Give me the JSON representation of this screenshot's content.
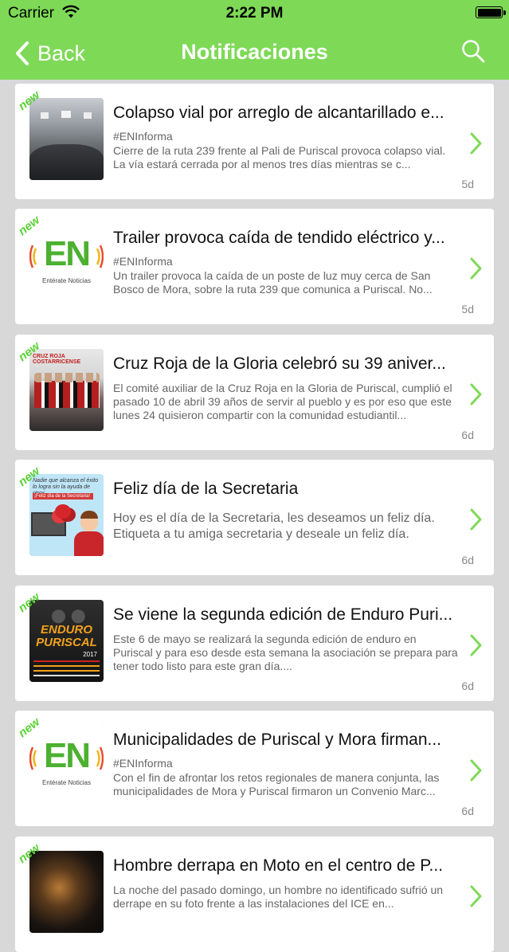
{
  "status_bar": {
    "carrier": "Carrier",
    "time": "2:22 PM"
  },
  "nav": {
    "back_label": "Back",
    "title": "Notificaciones"
  },
  "colors": {
    "accent": "#7ed957",
    "new_badge": "#5cd137",
    "chevron": "#7ed957"
  },
  "notifications": [
    {
      "badge": "new",
      "title": "Colapso vial por arreglo de alcantarillado e...",
      "tag": "#ENInforma",
      "description": "Cierre de la ruta 239 frente al Pali de Puriscal provoca colapso vial.  La vía estará cerrada por al menos tres días mientras se c...",
      "age": "5d",
      "thumb": "road-photo"
    },
    {
      "badge": "new",
      "title": "Trailer provoca caída de tendido eléctrico y...",
      "tag": "#ENInforma",
      "description": "Un trailer provoca la caída de un poste de luz muy cerca de San Bosco de Mora,  sobre la ruta 239 que comunica a Puriscal.  No...",
      "age": "5d",
      "thumb": "en-logo",
      "logo_text": "EN",
      "logo_sub": "Entérate Noticias"
    },
    {
      "badge": "new",
      "title": "Cruz Roja de la Gloria celebró su 39 aniver...",
      "tag": "",
      "description": "El comité auxiliar de la Cruz Roja en la Gloria de Puriscal, cumplió el pasado 10 de abril 39 años de servir al pueblo y es por eso que este lunes 24 quisieron compartir con la comunidad estudiantil...",
      "age": "6d",
      "thumb": "red-cross-photo",
      "thumb_text": "CRUZ ROJA COSTARRICENSE"
    },
    {
      "badge": "new",
      "title": "Feliz día de la Secretaria",
      "tag": "",
      "description": "Hoy es el día de la Secretaria, les deseamos un feliz día. Etiqueta a tu amiga secretaria y deseale un feliz día.",
      "age": "6d",
      "thumb": "secretary-card",
      "thumb_text": "Nadie que alcanza el éxito lo logra sin la ayuda de otros",
      "thumb_sub": "¡Feliz día de la Secretaria!"
    },
    {
      "badge": "new",
      "title": "Se viene la segunda edición de Enduro Puri...",
      "tag": "",
      "description": "Este 6 de mayo se realizará la segunda edición de enduro en Puriscal y para eso desde esta semana la asociación se prepara para tener todo listo para este gran día....",
      "age": "6d",
      "thumb": "enduro-poster",
      "thumb_text": "ENDURO PURISCAL",
      "thumb_year": "2017"
    },
    {
      "badge": "new",
      "title": "Municipalidades de Puriscal y Mora firman...",
      "tag": "#ENInforma",
      "description": "Con el fin de afrontar los retos regionales de manera conjunta, las municipalidades de Mora y Puriscal firmaron un Convenio Marc...",
      "age": "6d",
      "thumb": "en-logo",
      "logo_text": "EN",
      "logo_sub": "Entérate Noticias"
    },
    {
      "badge": "new",
      "title": "Hombre derrapa en Moto en el centro de P...",
      "tag": "",
      "description": "La noche del pasado domingo, un hombre no identificado sufrió un derrape en su foto frente a las instalaciones del ICE en...",
      "age": "",
      "thumb": "night-photo"
    }
  ]
}
